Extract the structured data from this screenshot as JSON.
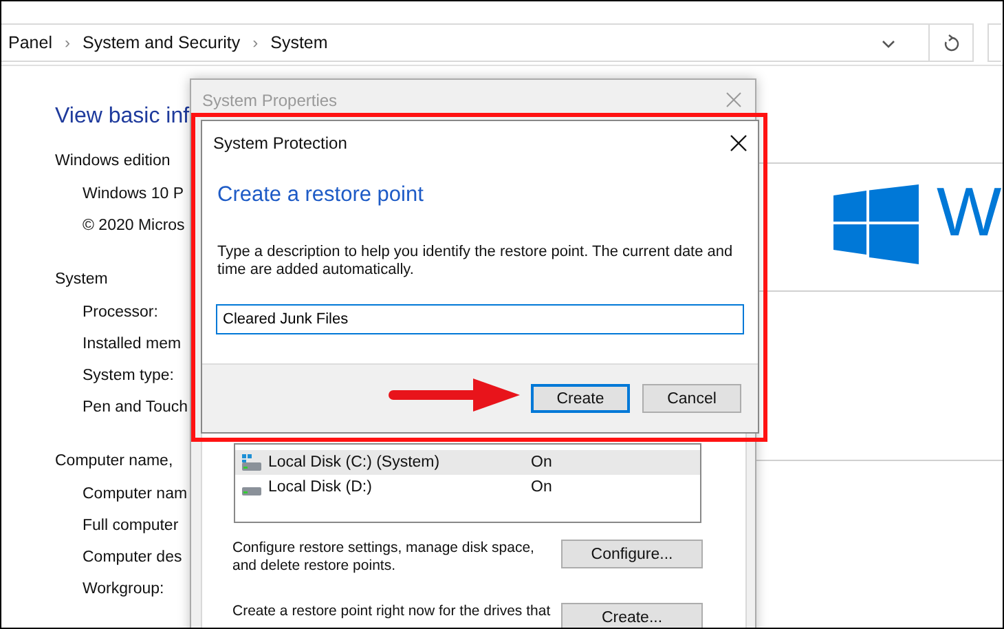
{
  "address_bar": {
    "breadcrumbs": [
      "Panel",
      "System and Security",
      "System"
    ],
    "separator": "›"
  },
  "page": {
    "heading": "View basic inf",
    "sections": [
      {
        "title": "Windows edition",
        "items": [
          "Windows 10 P",
          "© 2020 Micros"
        ]
      },
      {
        "title": "System",
        "items": [
          "Processor:",
          "Installed mem",
          "System type:",
          "Pen and Touch"
        ]
      },
      {
        "title": "Computer name,",
        "items": [
          "Computer nam",
          "Full computer",
          "Computer des",
          "Workgroup:"
        ]
      }
    ],
    "logo_letter": "W"
  },
  "system_properties": {
    "title": "System Properties",
    "drives": [
      {
        "name": "Local Disk (C:) (System)",
        "protection": "On",
        "system": true,
        "selected": true
      },
      {
        "name": "Local Disk (D:)",
        "protection": "On",
        "system": false,
        "selected": false
      }
    ],
    "actions": [
      {
        "text": "Configure restore settings, manage disk space, and delete restore points.",
        "button": "Configure..."
      },
      {
        "text": "Create a restore point right now for the drives that",
        "button": "Create..."
      }
    ]
  },
  "dialog": {
    "title": "System Protection",
    "heading": "Create a restore point",
    "description": "Type a description to help you identify the restore point. The current date and time are added automatically.",
    "input_value": "Cleared Junk Files",
    "buttons": [
      {
        "label": "Create",
        "default": true
      },
      {
        "label": "Cancel",
        "default": false
      }
    ]
  }
}
